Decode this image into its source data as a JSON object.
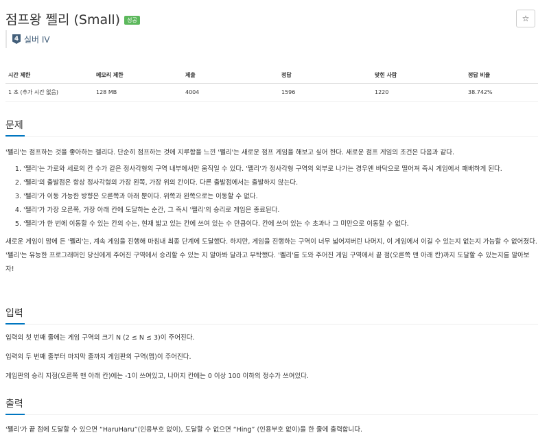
{
  "header": {
    "title": "점프왕 쩰리 (Small)",
    "badge": "성공",
    "star_icon": "☆",
    "tier_level": "4",
    "tier_name": "실버 IV"
  },
  "info": {
    "headers": [
      "시간 제한",
      "메모리 제한",
      "제출",
      "정답",
      "맞힌 사람",
      "정답 비율"
    ],
    "values": [
      "1 초 (추가 시간 없음)",
      "128 MB",
      "4004",
      "1596",
      "1220",
      "38.742%"
    ]
  },
  "problem": {
    "heading": "문제",
    "intro": "'쩰리'는 점프하는 것을 좋아하는 젤리다. 단순히 점프하는 것에 지루함을 느낀 '쩰리'는 새로운 점프 게임을 해보고 싶어 한다. 새로운 점프 게임의 조건은 다음과 같다.",
    "rules": [
      "'쩰리'는 가로와 세로의 칸 수가 같은 정사각형의 구역 내부에서만 움직일 수 있다. '쩰리'가 정사각형 구역의 외부로 나가는 경우엔 바닥으로 떨어져 즉시 게임에서 패배하게 된다.",
      "'쩰리'의 출발점은 항상 정사각형의 가장 왼쪽, 가장 위의 칸이다. 다른 출발점에서는 출발하지 않는다.",
      "'쩰리'가 이동 가능한 방향은 오른쪽과 아래 뿐이다. 위쪽과 왼쪽으로는 이동할 수 없다.",
      "'쩰리'가 가장 오른쪽, 가장 아래 칸에 도달하는 순간, 그 즉시 '쩰리'의 승리로 게임은 종료된다.",
      "'쩰리'가 한 번에 이동할 수 있는 칸의 수는, 현재 밟고 있는 칸에 쓰여 있는 수 만큼이다. 칸에 쓰여 있는 수 초과나 그 미만으로 이동할 수 없다."
    ],
    "outro": "새로운 게임이 맘에 든 '쩰리'는, 계속 게임을 진행해 마침내 최종 단계에 도달했다. 하지만, 게임을 진행하는 구역이 너무 넓어져버린 나머지, 이 게임에서 이길 수 있는지 없는지 가늠할 수 없어졌다. '쩰리'는 유능한 프로그래머인 당신에게 주어진 구역에서 승리할 수 있는 지 알아봐 달라고 부탁했다. '쩰리'를 도와 주어진 게임 구역에서 끝 점(오른쪽 맨 아래 칸)까지 도달할 수 있는지를 알아보자!"
  },
  "input": {
    "heading": "입력",
    "lines": [
      "입력의 첫 번째 줄에는 게임 구역의 크기 N (2 ≤ N ≤ 3)이 주어진다.",
      "입력의 두 번째 줄부터 마지막 줄까지 게임판의 구역(맵)이 주어진다.",
      "게임판의 승리 지점(오른쪽 맨 아래 칸)에는 -1이 쓰여있고, 나머지 칸에는 0 이상 100 이하의 정수가 쓰여있다."
    ]
  },
  "output": {
    "heading": "출력",
    "line": "'쩰리'가 끝 점에 도달할 수 있으면 “HaruHaru”(인용부호 없이), 도달할 수 없으면 “Hing” (인용부호 없이)을 한 줄에 출력합니다."
  }
}
